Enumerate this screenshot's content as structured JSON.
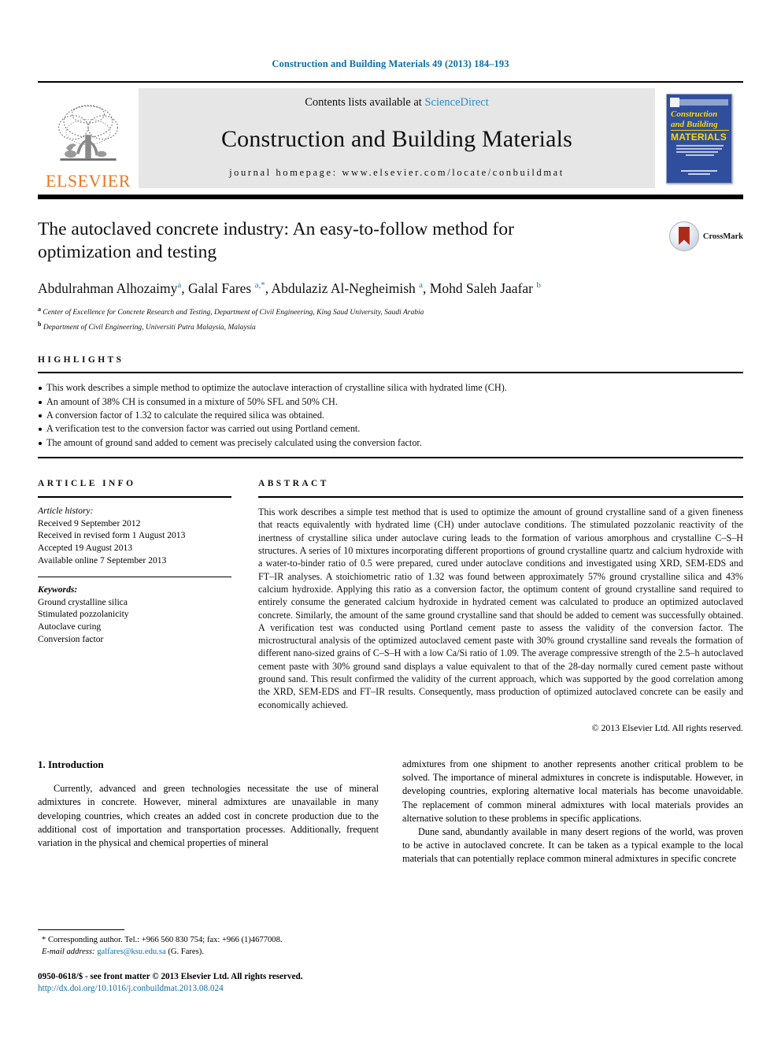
{
  "running_head": "Construction and Building Materials 49 (2013) 184–193",
  "masthead": {
    "publisher_name": "ELSEVIER",
    "contents_prefix": "Contents lists available at ",
    "contents_link": "ScienceDirect",
    "journal_name": "Construction and Building Materials",
    "homepage_line": "journal homepage: www.elsevier.com/locate/conbuildmat",
    "cover": {
      "title_line1": "Construction",
      "title_line2": "and Building",
      "title_line3": "MATERIALS"
    }
  },
  "article": {
    "title": "The autoclaved concrete industry: An easy-to-follow method for optimization and testing",
    "authors_html": "Abdulrahman Alhozaimy<sup>a</sup>, Galal Fares <sup>a,*</sup>, Abdulaziz Al-Negheimish <sup>a</sup>, Mohd Saleh Jaafar <sup>b</sup>",
    "affiliation_a": "Center of Excellence for Concrete Research and Testing, Department of Civil Engineering, King Saud University, Saudi Arabia",
    "affiliation_b": "Department of Civil Engineering, Universiti Putra Malaysia, Malaysia",
    "crossmark_label": "CrossMark"
  },
  "highlights": {
    "label": "HIGHLIGHTS",
    "items": [
      "This work describes a simple method to optimize the autoclave interaction of crystalline silica with hydrated lime (CH).",
      "An amount of 38% CH is consumed in a mixture of 50% SFL and 50% CH.",
      "A conversion factor of 1.32 to calculate the required silica was obtained.",
      "A verification test to the conversion factor was carried out using Portland cement.",
      "The amount of ground sand added to cement was precisely calculated using the conversion factor."
    ]
  },
  "article_info": {
    "label": "ARTICLE INFO",
    "history_heading": "Article history:",
    "history": [
      "Received 9 September 2012",
      "Received in revised form 1 August 2013",
      "Accepted 19 August 2013",
      "Available online 7 September 2013"
    ],
    "keywords_heading": "Keywords:",
    "keywords": [
      "Ground crystalline silica",
      "Stimulated pozzolanicity",
      "Autoclave curing",
      "Conversion factor"
    ]
  },
  "abstract": {
    "label": "ABSTRACT",
    "text": "This work describes a simple test method that is used to optimize the amount of ground crystalline sand of a given fineness that reacts equivalently with hydrated lime (CH) under autoclave conditions. The stimulated pozzolanic reactivity of the inertness of crystalline silica under autoclave curing leads to the formation of various amorphous and crystalline C–S–H structures. A series of 10 mixtures incorporating different proportions of ground crystalline quartz and calcium hydroxide with a water-to-binder ratio of 0.5 were prepared, cured under autoclave conditions and investigated using XRD, SEM-EDS and FT–IR analyses. A stoichiometric ratio of 1.32 was found between approximately 57% ground crystalline silica and 43% calcium hydroxide. Applying this ratio as a conversion factor, the optimum content of ground crystalline sand required to entirely consume the generated calcium hydroxide in hydrated cement was calculated to produce an optimized autoclaved concrete. Similarly, the amount of the same ground crystalline sand that should be added to cement was successfully obtained. A verification test was conducted using Portland cement paste to assess the validity of the conversion factor. The microstructural analysis of the optimized autoclaved cement paste with 30% ground crystalline sand reveals the formation of different nano-sized grains of C–S–H with a low Ca/Si ratio of 1.09. The average compressive strength of the 2.5–h autoclaved cement paste with 30% ground sand displays a value equivalent to that of the 28-day normally cured cement paste without ground sand. This result confirmed the validity of the current approach, which was supported by the good correlation among the XRD, SEM-EDS and FT–IR results. Consequently, mass production of optimized autoclaved concrete can be easily and economically achieved.",
    "copyright": "© 2013 Elsevier Ltd. All rights reserved."
  },
  "introduction": {
    "heading": "1. Introduction",
    "left_paragraph": "Currently, advanced and green technologies necessitate the use of mineral admixtures in concrete. However, mineral admixtures are unavailable in many developing countries, which creates an added cost in concrete production due to the additional cost of importation and transportation processes. Additionally, frequent variation in the physical and chemical properties of mineral",
    "right_paragraph_1": "admixtures from one shipment to another represents another critical problem to be solved. The importance of mineral admixtures in concrete is indisputable. However, in developing countries, exploring alternative local materials has become unavoidable. The replacement of common mineral admixtures with local materials provides an alternative solution to these problems in specific applications.",
    "right_paragraph_2": "Dune sand, abundantly available in many desert regions of the world, was proven to be active in autoclaved concrete. It can be taken as a typical example to the local materials that can potentially replace common mineral admixtures in specific concrete"
  },
  "footnote": {
    "corresponding": "* Corresponding author. Tel.: +966 560 830 754; fax: +966 (1)4677008.",
    "email_label": "E-mail address:",
    "email": "galfares@ksu.edu.sa",
    "email_suffix": "(G. Fares)."
  },
  "footer": {
    "issn_line": "0950-0618/$ - see front matter © 2013 Elsevier Ltd. All rights reserved.",
    "doi": "http://dx.doi.org/10.1016/j.conbuildmat.2013.08.024"
  },
  "colors": {
    "link_blue": "#0b6ea8",
    "sciencedirect_blue": "#2b8fc4",
    "elsevier_orange": "#e87722",
    "cover_blue": "#2f4f9e",
    "cover_yellow": "#ffd700",
    "crossmark_red": "#ab2b18"
  }
}
